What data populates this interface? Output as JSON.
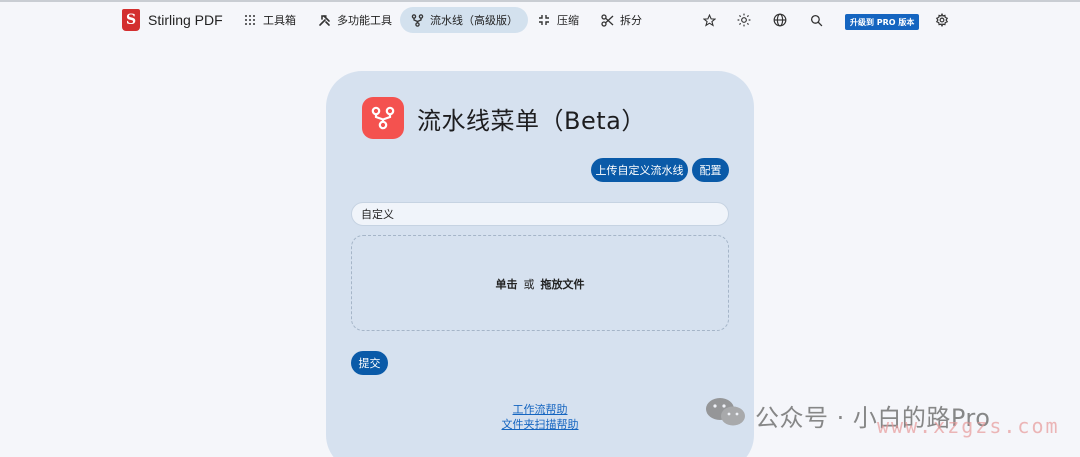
{
  "app": {
    "name": "Stirling PDF",
    "logo_letter": "S"
  },
  "nav": {
    "items": [
      {
        "label": "工具箱",
        "icon": "grid-icon"
      },
      {
        "label": "多功能工具",
        "icon": "tools-icon"
      },
      {
        "label": "流水线（高级版）",
        "icon": "pipeline-icon",
        "active": true
      },
      {
        "label": "压缩",
        "icon": "compress-icon"
      },
      {
        "label": "拆分",
        "icon": "scissors-icon"
      }
    ],
    "right": {
      "favorites_icon": "star-icon",
      "theme_icon": "sun-icon",
      "language_icon": "globe-icon",
      "search_icon": "search-icon",
      "pro_label": "升级到 PRO 版本",
      "settings_icon": "gear-icon"
    }
  },
  "card": {
    "title": "流水线菜单（Beta）",
    "upload_button": "上传自定义流水线",
    "config_button": "配置",
    "select_value": "自定义",
    "drop_click": "单击",
    "drop_or": "或",
    "drop_drag": "拖放文件",
    "submit_button": "提交",
    "help_link_1": "工作流帮助",
    "help_link_2": "文件夹扫描帮助"
  },
  "watermark": {
    "text": "公众号 · 小白的路Pro",
    "url": "www.xzgzs.com"
  },
  "colors": {
    "accent": "#0a5aa8",
    "card_bg": "#d6e1ef",
    "brand_red": "#d32f2f",
    "pipeline_badge": "#f4524f"
  }
}
